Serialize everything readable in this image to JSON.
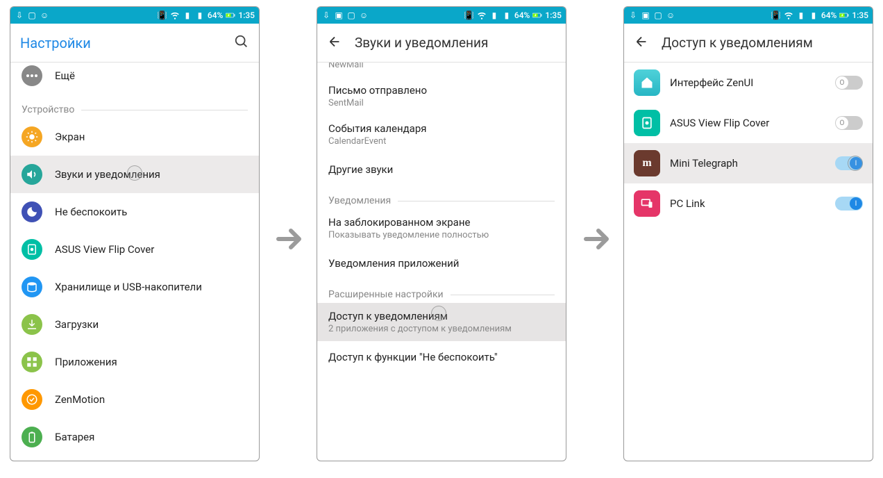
{
  "statusbar": {
    "battery_pct": "64%",
    "time": "1:35"
  },
  "screen1": {
    "title": "Настройки",
    "row_more": "Ещё",
    "section_device": "Устройство",
    "items": [
      "Экран",
      "Звуки и уведомления",
      "Не беспокоить",
      "ASUS View Flip Cover",
      "Хранилище и USB-накопители",
      "Загрузки",
      "Приложения",
      "ZenMotion",
      "Батарея"
    ]
  },
  "screen2": {
    "title": "Звуки и уведомления",
    "partial_item": {
      "sub": "NewMail"
    },
    "items_a": [
      {
        "t1": "Письмо отправлено",
        "t2": "SentMail"
      },
      {
        "t1": "События календаря",
        "t2": "CalendarEvent"
      },
      {
        "t1": "Другие звуки",
        "t2": ""
      }
    ],
    "section_notif": "Уведомления",
    "items_b": [
      {
        "t1": "На заблокированном экране",
        "t2": "Показывать уведомление полностью"
      },
      {
        "t1": "Уведомления приложений",
        "t2": ""
      }
    ],
    "section_adv": "Расширенные настройки",
    "items_c": [
      {
        "t1": "Доступ к уведомлениям",
        "t2": "2 приложения с доступом к уведомлениям",
        "hl": true
      },
      {
        "t1": "Доступ к функции \"Не беспокоить\"",
        "t2": ""
      }
    ]
  },
  "screen3": {
    "title": "Доступ к уведомлениям",
    "apps": [
      {
        "name": "Интерфейс ZenUI",
        "on": false,
        "knob_label": "O"
      },
      {
        "name": "ASUS View Flip Cover",
        "on": false,
        "knob_label": "O"
      },
      {
        "name": "Mini Telegraph",
        "on": true,
        "knob_label": "I",
        "hl": true
      },
      {
        "name": "PC Link",
        "on": true,
        "knob_label": "I"
      }
    ]
  }
}
